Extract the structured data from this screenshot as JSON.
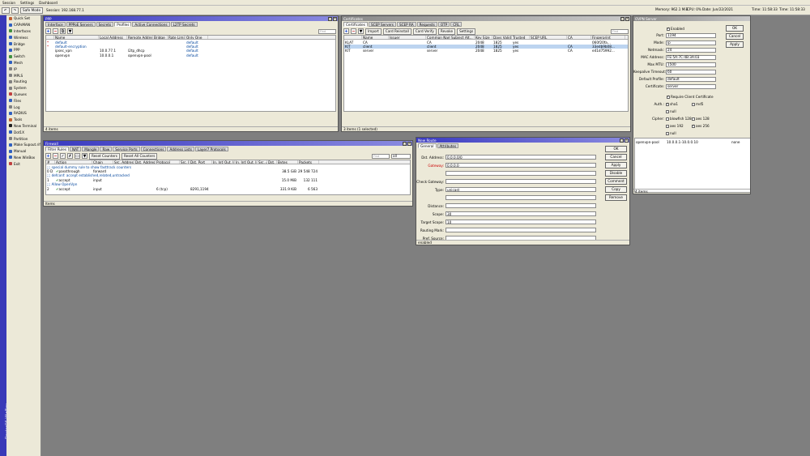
{
  "menubar": {
    "items": [
      "Session",
      "Settings",
      "Dashboard"
    ]
  },
  "toolbar": {
    "undo": "↶",
    "redo": "↷",
    "safe_mode": "Safe Mode",
    "session_label": "Session: 192.168.77.1",
    "memory": "Memory: 962.1 MiB",
    "cpu": "CPU: 0%",
    "date": "Date: Jun/22/2021",
    "time1": "Time: 11:58:33",
    "time2": "Time: 11:58:33"
  },
  "sidebar": {
    "brand": "RouterOS WinBox",
    "items": [
      {
        "label": "Quick Set",
        "color": "#c06030"
      },
      {
        "label": "CAPsMAN",
        "color": "#3060c0"
      },
      {
        "label": "Interfaces",
        "color": "#409040"
      },
      {
        "label": "Wireless",
        "color": "#3060c0"
      },
      {
        "label": "Bridge",
        "color": "#3060c0"
      },
      {
        "label": "PPP",
        "color": "#3060c0"
      },
      {
        "label": "Switch",
        "color": "#409040"
      },
      {
        "label": "Mesh",
        "color": "#3060c0"
      },
      {
        "label": "IP",
        "color": "#808080"
      },
      {
        "label": "MPLS",
        "color": "#808080"
      },
      {
        "label": "Routing",
        "color": "#808080"
      },
      {
        "label": "System",
        "color": "#808080"
      },
      {
        "label": "Queues",
        "color": "#c04040"
      },
      {
        "label": "Files",
        "color": "#3060c0"
      },
      {
        "label": "Log",
        "color": "#808080"
      },
      {
        "label": "RADIUS",
        "color": "#3060c0"
      },
      {
        "label": "Tools",
        "color": "#c06030"
      },
      {
        "label": "New Terminal",
        "color": "#202020"
      },
      {
        "label": "Dot1X",
        "color": "#3060c0"
      },
      {
        "label": "Partition",
        "color": "#808080"
      },
      {
        "label": "Make Supout.rif",
        "color": "#3060c0"
      },
      {
        "label": "Manual",
        "color": "#3060c0"
      },
      {
        "label": "New WinBox",
        "color": "#3060c0"
      },
      {
        "label": "Exit",
        "color": "#c04040"
      }
    ]
  },
  "ppp": {
    "title": "PPP",
    "tabs": [
      "Interface",
      "PPPoE Servers",
      "Secrets",
      "Profiles",
      "Active Connections",
      "L2TP Secrets"
    ],
    "active_tab": "Profiles",
    "find": "Find",
    "columns": [
      "Name",
      "Local Address",
      "Remote Address",
      "Bridge",
      "Rate Limi...",
      "Only One"
    ],
    "rows": [
      {
        "mark": "*",
        "name": "default",
        "local": "",
        "remote": "",
        "bridge": "",
        "rate": "",
        "only": "default"
      },
      {
        "mark": "*",
        "name": "default-encryption",
        "local": "",
        "remote": "",
        "bridge": "",
        "rate": "",
        "only": "default"
      },
      {
        "mark": "",
        "name": "ipsec_vpn",
        "local": "10.0.77.1",
        "remote": "l2tp_dhcp",
        "bridge": "",
        "rate": "",
        "only": "default"
      },
      {
        "mark": "",
        "name": "openvpn",
        "local": "10.0.0.1",
        "remote": "openvpn-pool",
        "bridge": "",
        "rate": "",
        "only": "default"
      }
    ],
    "status": "4 items"
  },
  "certs": {
    "title": "Certificates",
    "tabs": [
      "Certificates",
      "SCEP Servers",
      "SCEP RA",
      "Requests",
      "OTP",
      "CRL"
    ],
    "active_tab": "Certificates",
    "buttons": [
      "Import",
      "Card Reinstall",
      "Card Verify",
      "Revoke",
      "Settings"
    ],
    "find": "Find",
    "columns": [
      "",
      "Name",
      "Issuer",
      "Common Name",
      "Subject Alt...",
      "Key Size",
      "Days Valid",
      "Trusted",
      "SCEP URL",
      "CA",
      "Fingerprint"
    ],
    "rows": [
      {
        "flags": "KLAT",
        "name": "CA",
        "issuer": "",
        "cn": "CA",
        "alt": "",
        "key": "2048",
        "days": "1825",
        "trusted": "yes",
        "scep": "",
        "ca": "",
        "fp": "060f20fa...",
        "sel": false
      },
      {
        "flags": "KIT",
        "name": "client",
        "issuer": "",
        "cn": "client",
        "alt": "",
        "key": "2048",
        "days": "1825",
        "trusted": "yes",
        "scep": "",
        "ca": "CA",
        "fp": "33edb9b08...",
        "sel": true
      },
      {
        "flags": "KIT",
        "name": "server",
        "issuer": "",
        "cn": "server",
        "alt": "",
        "key": "2048",
        "days": "1825",
        "trusted": "yes",
        "scep": "",
        "ca": "CA",
        "fp": "e41d75992...",
        "sel": false
      }
    ],
    "status": "3 items (1 selected)"
  },
  "ovpn": {
    "title": "OVPN Server",
    "enabled_label": "Enabled",
    "fields": [
      {
        "label": "Port:",
        "value": "1194"
      },
      {
        "label": "Mode:",
        "value": "ip"
      },
      {
        "label": "Netmask:",
        "value": "24"
      },
      {
        "label": "MAC Address:",
        "value": "FE:5A:7C:4B:3A:03"
      },
      {
        "label": "Max MTU:",
        "value": "1500"
      },
      {
        "label": "Keepalive Timeout:",
        "value": "60"
      },
      {
        "label": "Default Profile:",
        "value": "default"
      },
      {
        "label": "Certificate:",
        "value": "server"
      }
    ],
    "require_client_cert": "Require Client Certificate",
    "auth_label": "Auth.:",
    "auth": [
      {
        "name": "sha1",
        "checked": true
      },
      {
        "name": "md5",
        "checked": false
      },
      {
        "name": "null",
        "checked": false
      }
    ],
    "cipher_label": "Cipher:",
    "cipher": [
      {
        "name": "blowfish 128",
        "checked": false
      },
      {
        "name": "aes 128",
        "checked": false
      },
      {
        "name": "aes 192",
        "checked": false
      },
      {
        "name": "aes 256",
        "checked": true
      },
      {
        "name": "null",
        "checked": false
      }
    ],
    "buttons": [
      "OK",
      "Cancel",
      "Apply"
    ]
  },
  "pool": {
    "row": {
      "name": "openvpn-pool",
      "ranges": "10.0.0.1-10.0.0.10",
      "next": "none"
    },
    "status": "4 items"
  },
  "firewall": {
    "title": "Firewall",
    "tabs": [
      "Filter Rules",
      "NAT",
      "Mangle",
      "Raw",
      "Service Ports",
      "Connections",
      "Address Lists",
      "Layer7 Protocols"
    ],
    "active_tab": "Filter Rules",
    "reset_counters": "Reset Counters",
    "reset_all": "Reset All Counters",
    "find": "Find",
    "filter_value": "all",
    "columns": [
      "#",
      "Action",
      "Chain",
      "Src. Address",
      "Dst. Address",
      "Protocol",
      "Src. Port",
      "Dst. Port",
      "In. Inter...",
      "Out. Int...",
      "In. Inter...",
      "Out. Int...",
      "Src. Ad...",
      "Dst. Ad...",
      "Bytes",
      "Packets"
    ],
    "rows": [
      {
        "type": "comment",
        "text": ";;; special dummy rule to show fasttrack counters"
      },
      {
        "type": "rule",
        "num": "0 D",
        "action": "passthrough",
        "chain": "forward",
        "proto": "",
        "dport": "",
        "iniface": "",
        "bytes": "38.5 GiB",
        "packets": "29 548 724"
      },
      {
        "type": "comment",
        "text": ";;; defconf: accept established,related,untracked"
      },
      {
        "type": "rule",
        "num": "1",
        "action": "accept",
        "chain": "input",
        "proto": "",
        "dport": "",
        "iniface": "",
        "bytes": "15.0 MiB",
        "packets": "132 111"
      },
      {
        "type": "comment",
        "text": ";;; Allow OpenVpn"
      },
      {
        "type": "rule",
        "num": "2",
        "action": "accept",
        "chain": "input",
        "proto": "6 (tcp)",
        "dport": "8291,1194",
        "iniface": "",
        "bytes": "331.9 KiB",
        "packets": "6 563"
      }
    ],
    "status": "Items"
  },
  "route": {
    "title": "New Route",
    "tabs": [
      "General",
      "Attributes"
    ],
    "active_tab": "General",
    "fields": [
      {
        "label": "Dst. Address:",
        "value": "0.0.0.0/0",
        "red": false
      },
      {
        "label": "Gateway:",
        "value": "0.0.0.0",
        "red": true
      },
      {
        "label": "",
        "value": "",
        "red": false
      },
      {
        "label": "Check Gateway:",
        "value": "",
        "red": false
      },
      {
        "label": "Type:",
        "value": "unicast",
        "red": false
      },
      {
        "label": "",
        "value": "",
        "red": false
      },
      {
        "label": "Distance:",
        "value": "",
        "red": false
      },
      {
        "label": "Scope:",
        "value": "30",
        "red": false
      },
      {
        "label": "Target Scope:",
        "value": "10",
        "red": false
      },
      {
        "label": "Routing Mark:",
        "value": "",
        "red": false
      },
      {
        "label": "Pref. Source:",
        "value": "",
        "red": false
      }
    ],
    "buttons": [
      "OK",
      "Cancel",
      "Apply",
      "Disable",
      "Comment",
      "Copy",
      "Remove"
    ],
    "status": "enabled"
  }
}
